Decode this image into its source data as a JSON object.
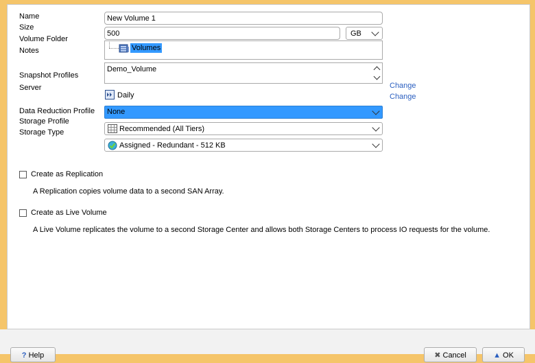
{
  "labels": {
    "name": "Name",
    "size": "Size",
    "volume_folder": "Volume Folder",
    "notes": "Notes",
    "snapshot_profiles": "Snapshot Profiles",
    "server": "Server",
    "data_reduction_profile": "Data Reduction Profile",
    "storage_profile": "Storage Profile",
    "storage_type": "Storage Type"
  },
  "fields": {
    "name_value": "New Volume 1",
    "size_value": "500",
    "size_unit": "GB",
    "volume_folder": "Volumes",
    "snapshot_profile": "Demo_Volume",
    "server_value": "Daily",
    "data_reduction": "None",
    "storage_profile": "Recommended (All Tiers)",
    "storage_type": "Assigned - Redundant - 512 KB"
  },
  "links": {
    "change_snapshot": "Change",
    "change_server": "Change"
  },
  "options": {
    "replication_label": "Create as Replication",
    "replication_desc": "A Replication copies volume data to a second SAN Array.",
    "live_volume_label": "Create as Live Volume",
    "live_volume_desc": "A Live Volume replicates the volume to a second Storage Center and allows both Storage Centers to process IO requests for the volume."
  },
  "buttons": {
    "help": "Help",
    "cancel": "Cancel",
    "ok": "OK"
  },
  "colors": {
    "accent": "#3399ff",
    "window_frame": "#f5c56a",
    "link": "#2b5fc0"
  }
}
